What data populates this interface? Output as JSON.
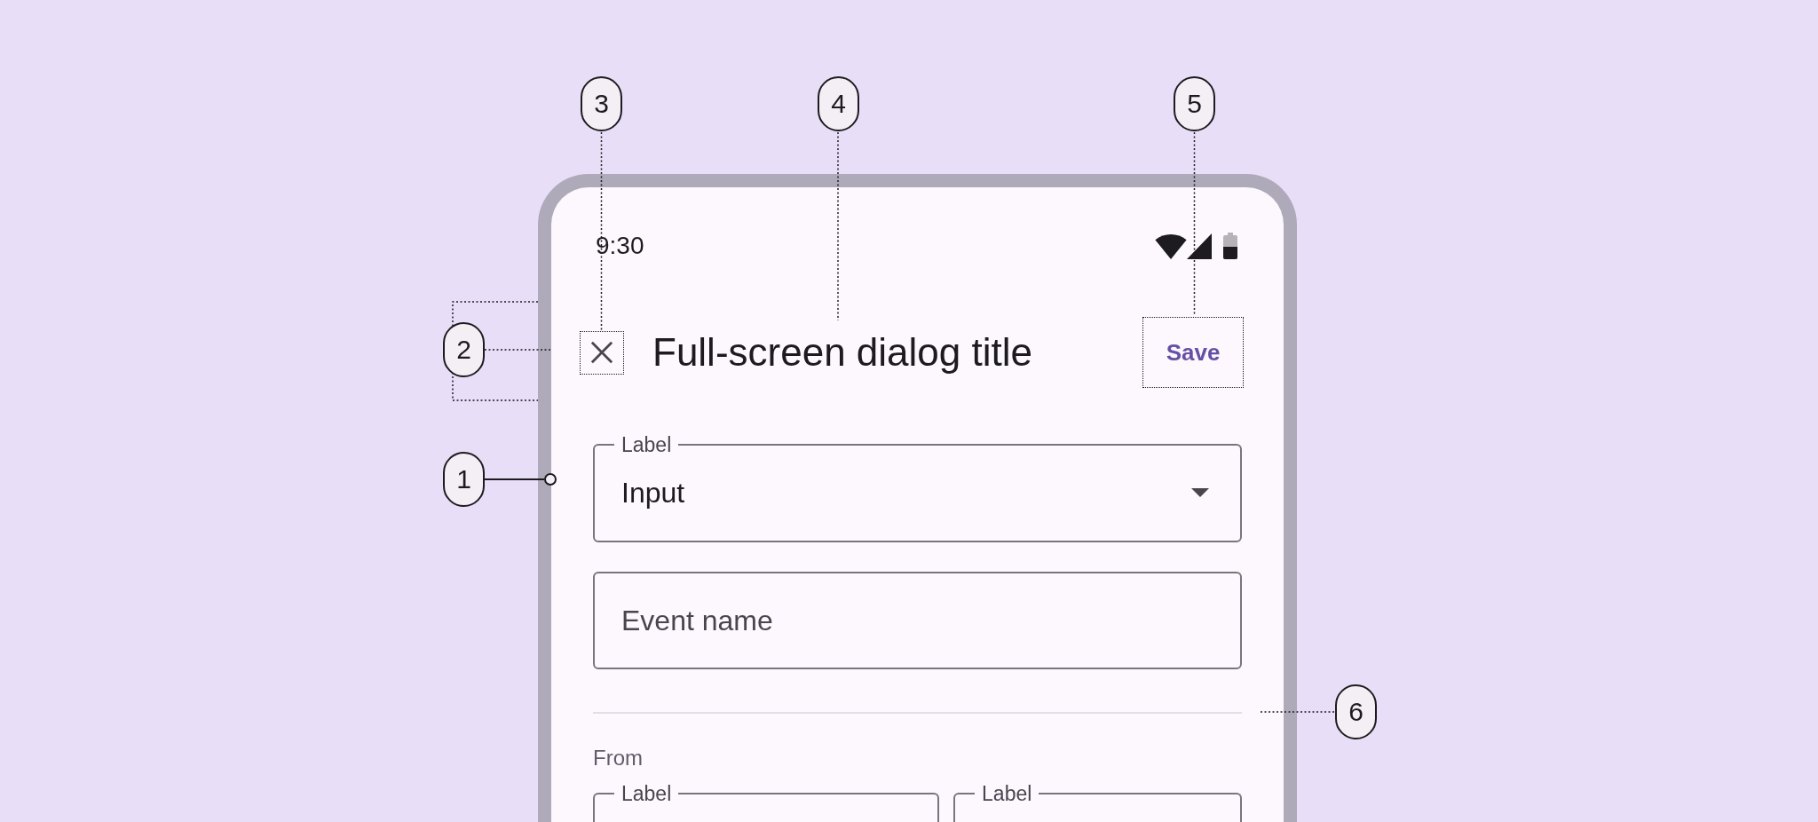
{
  "callouts": [
    {
      "label": "3",
      "kind": "dotted"
    },
    {
      "label": "4",
      "kind": "dotted"
    },
    {
      "label": "5",
      "kind": "dotted"
    },
    {
      "label": "2",
      "kind": "bracket"
    },
    {
      "label": "1",
      "kind": "pointer"
    },
    {
      "label": "6",
      "kind": "dotted"
    }
  ],
  "status_bar": {
    "time": "9:30"
  },
  "app_bar": {
    "title": "Full-screen dialog title",
    "action": "Save"
  },
  "form": {
    "fields": [
      {
        "kind": "dropdown",
        "label": "Label",
        "floating": true,
        "value": "Input"
      },
      {
        "kind": "text",
        "label": "Event name",
        "floating": false
      }
    ],
    "section": {
      "heading": "From",
      "fields": [
        {
          "kind": "text",
          "label": "Label",
          "floating": true
        },
        {
          "kind": "text",
          "label": "Label",
          "floating": true
        }
      ]
    }
  }
}
